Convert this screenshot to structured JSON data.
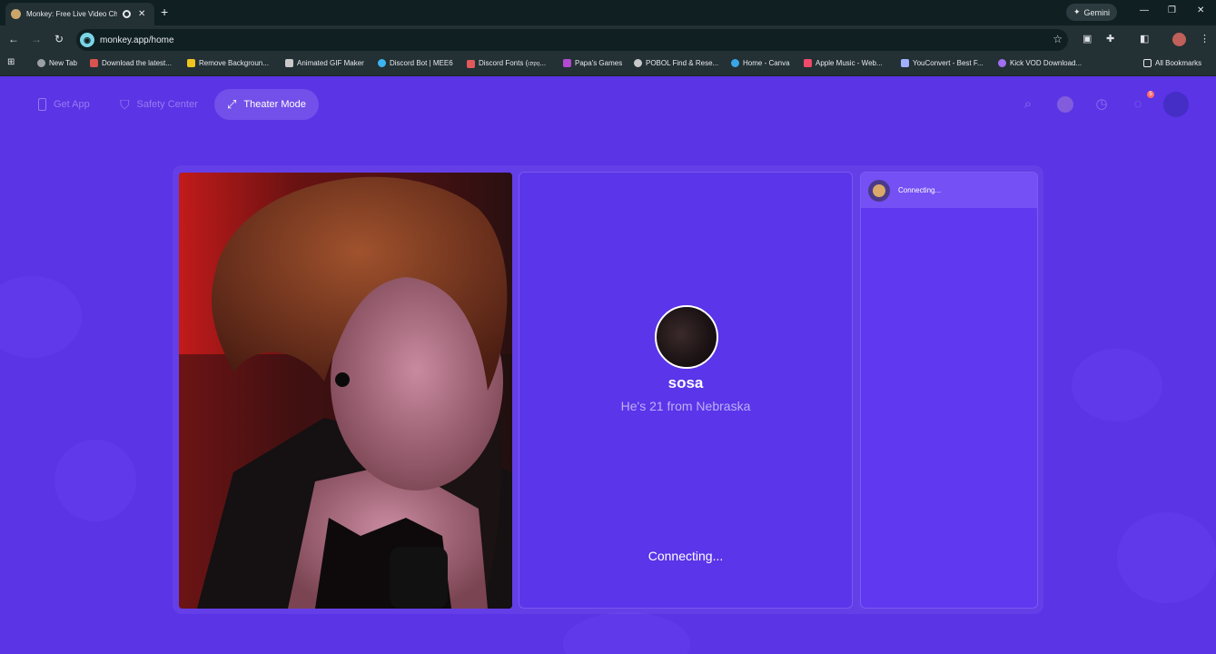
{
  "browser": {
    "tab_title": "Monkey: Free Live Video Ch",
    "gemini_label": "Gemini",
    "url": "monkey.app/home",
    "bookmarks": [
      {
        "label": "New Tab",
        "color": "#9aa0a6"
      },
      {
        "label": "Download the latest...",
        "color": "#d9534f"
      },
      {
        "label": "Remove Backgroun...",
        "color": "#f0c420"
      },
      {
        "label": "Animated GIF Maker",
        "color": "#c9c9c9"
      },
      {
        "label": "Discord Bot | MEE6",
        "color": "#3db3f0"
      },
      {
        "label": "Discord Fonts (𝔠𝔬𝔭𝔶...",
        "color": "#e05a5a"
      },
      {
        "label": "Papa's Games",
        "color": "#b04ad0"
      },
      {
        "label": "POBOL Find & Rese...",
        "color": "#c9c9c9"
      },
      {
        "label": "Home - Canva",
        "color": "#3aa6e8"
      },
      {
        "label": "Apple Music - Web...",
        "color": "#f04a6a"
      },
      {
        "label": "YouConvert - Best F...",
        "color": "#9fb0ff"
      },
      {
        "label": "Kick VOD Download...",
        "color": "#a070f0"
      }
    ],
    "all_bookmarks": "All Bookmarks"
  },
  "nav": {
    "get_app": "Get App",
    "safety_center": "Safety Center",
    "theater_mode": "Theater Mode",
    "notification_count": "5"
  },
  "partner": {
    "name": "sosa",
    "info": "He's 21 from Nebraska",
    "status": "Connecting..."
  },
  "chat": {
    "status": "Connecting..."
  }
}
